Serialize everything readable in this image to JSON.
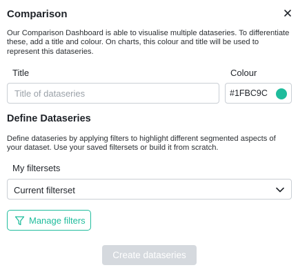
{
  "dialog": {
    "title": "Comparison",
    "description": "Our Comparison Dashboard is able to visualise multiple dataseries. To differentiate these, add a title and colour. On charts, this colour and title will be used to represent this dataseries."
  },
  "fields": {
    "title_label": "Title",
    "title_placeholder": "Title of dataseries",
    "title_value": "",
    "colour_label": "Colour",
    "colour_value": "#1FBC9C",
    "colour_swatch": "#1fbc9c"
  },
  "dataseries": {
    "heading": "Define Dataseries",
    "description": "Define dataseries by applying filters to highlight different segmented aspects of your dataset. Use your saved filtersets or build it from scratch.",
    "filtersets_label": "My filtersets",
    "selected_filterset": "Current filterset",
    "manage_filters_label": "Manage filters"
  },
  "actions": {
    "create_label": "Create dataseries",
    "create_enabled": false
  },
  "colors": {
    "accent": "#1fbc9c",
    "disabled_button": "#d5d9de"
  },
  "icons": {
    "close": "close-icon",
    "dropdown": "chevron-down-icon",
    "filter": "funnel-icon"
  }
}
